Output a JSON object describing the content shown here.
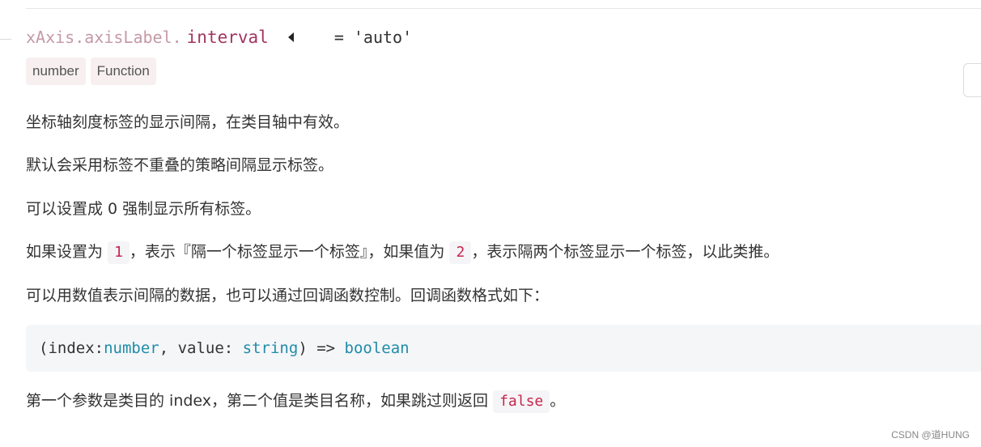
{
  "header": {
    "path": "xAxis.axisLabel.",
    "name": "interval",
    "default_value": "= 'auto'"
  },
  "types": [
    "number",
    "Function"
  ],
  "paragraphs": {
    "p1": "坐标轴刻度标签的显示间隔，在类目轴中有效。",
    "p2": "默认会采用标签不重叠的策略间隔显示标签。",
    "p3": "可以设置成 0 强制显示所有标签。",
    "p4": {
      "part1": "如果设置为",
      "code1": "1",
      "part2": "，表示『隔一个标签显示一个标签』，如果值为",
      "code2": "2",
      "part3": "，表示隔两个标签显示一个标签，以此类推。"
    },
    "p5": "可以用数值表示间隔的数据，也可以通过回调函数控制。回调函数格式如下：",
    "p6": {
      "part1": "第一个参数是类目的 index，第二个值是类目名称，如果跳过则返回",
      "code": "false",
      "part2": "。"
    }
  },
  "code_block": {
    "t1": "(index:",
    "t2": "number",
    "t3": ", value: ",
    "t4": "string",
    "t5": ") => ",
    "t6": "boolean"
  },
  "watermark": "CSDN @道HUNG",
  "icons": {
    "collapse": "caret-left-icon"
  },
  "colors": {
    "property_path": "#c49aa6",
    "property_name": "#a3355f",
    "inline_code": "#c7254e",
    "code_type": "#1f8ca8",
    "tag_bg": "#f7eff0"
  }
}
